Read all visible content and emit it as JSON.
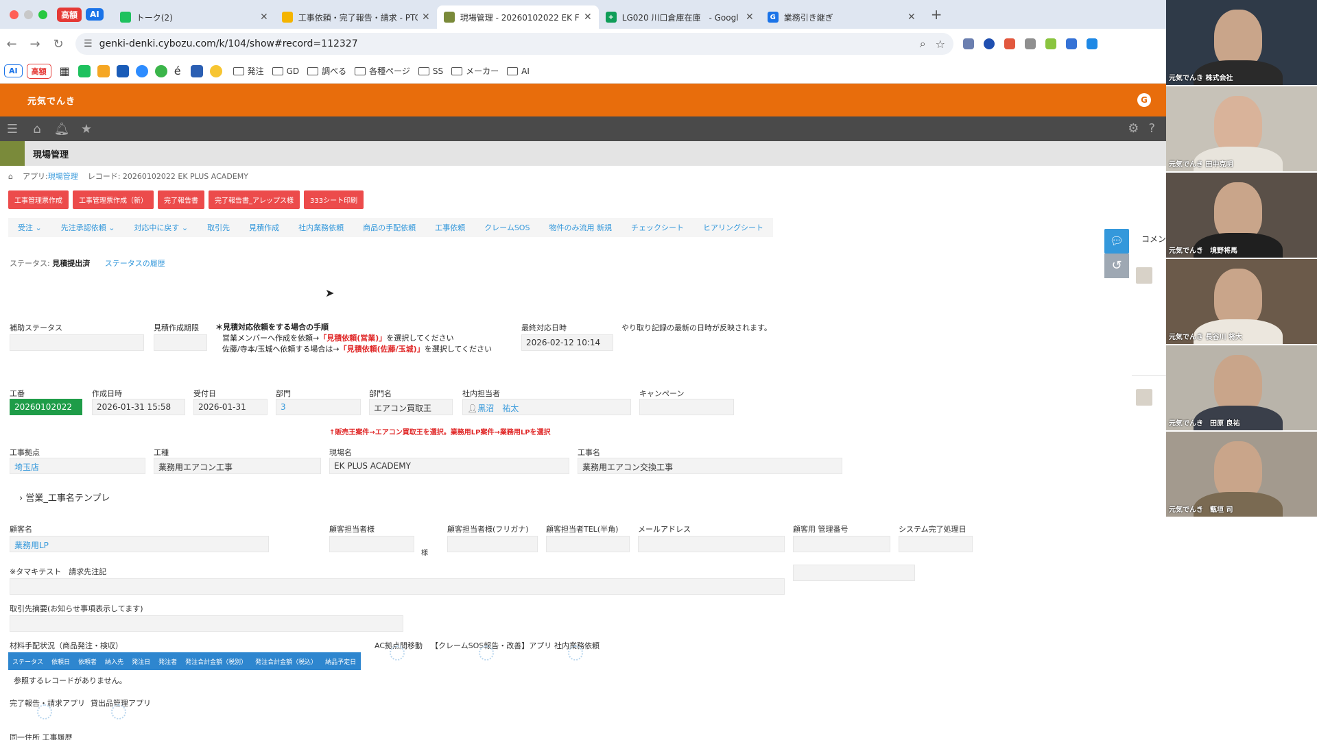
{
  "browser": {
    "pills": [
      "高額",
      "AI"
    ],
    "tabs": [
      {
        "title": "トーク(2)",
        "color": "#1ec15e"
      },
      {
        "title": "工事依頼・完了報告・請求 - PTC",
        "color": "#f4b400"
      },
      {
        "title": "現場管理 - 20260102022 EK F",
        "color": "#7a8a3a"
      },
      {
        "title": "LG020 川口倉庫在庫　- Googl",
        "color": "#0f9d58"
      },
      {
        "title": "業務引き継ぎ",
        "color": "#1a73e8"
      }
    ],
    "url": "genki-denki.cybozu.com/k/104/show#record=112327",
    "bookmarks": {
      "ai": "AI",
      "expensive": "高額",
      "folders": [
        "発注",
        "GD",
        "調べる",
        "各種ページ",
        "SS",
        "メーカー",
        "AI"
      ]
    }
  },
  "app": {
    "logo": "元気でんき",
    "user_initial": "G",
    "title": "現場管理",
    "breadcrumb_app_prefix": "アプリ:",
    "breadcrumb_app": "現場管理",
    "breadcrumb_record": "レコード: 20260102022 EK PLUS ACADEMY"
  },
  "red_buttons": [
    "工事管理票作成",
    "工事管理票作成（新）",
    "完了報告書",
    "完了報告書_アレップス様",
    "333シート印刷"
  ],
  "actions": [
    "受注",
    "先注承認依頼",
    "対応中に戻す",
    "取引先",
    "見積作成",
    "社内業務依頼",
    "商品の手配依頼",
    "工事依頼",
    "クレームSOS",
    "物件のみ流用 新規",
    "チェックシート",
    "ヒアリングシート"
  ],
  "status": {
    "label": "ステータス:",
    "value": "見積提出済",
    "history": "ステータスの履歴"
  },
  "fields": {
    "hojo_status": {
      "label": "補助ステータス",
      "value": ""
    },
    "mitsumori_kigen": {
      "label": "見積作成期限",
      "value": ""
    },
    "procedure": {
      "title": "＊見積対応依頼をする場合の手順",
      "line1_pre": "営業メンバーへ作成を依頼→",
      "line1_red": "「見積依頼(営業)」",
      "line1_post": "を選択してください",
      "line2_pre": "佐藤/寺本/玉城へ依頼する場合は→",
      "line2_red": "「見積依頼(佐藤/玉城)」",
      "line2_post": "を選択してください"
    },
    "last_response": {
      "label": "最終対応日時",
      "value": "2026-02-12 10:14"
    },
    "last_response_note": "やり取り記録の最新の日時が反映されます。",
    "koban": {
      "label": "工番",
      "value": "20260102022"
    },
    "created": {
      "label": "作成日時",
      "value": "2026-01-31 15:58"
    },
    "received": {
      "label": "受付日",
      "value": "2026-01-31"
    },
    "dept": {
      "label": "部門",
      "value": "3"
    },
    "dept_name": {
      "label": "部門名",
      "value": "エアコン買取王"
    },
    "staff": {
      "label": "社内担当者",
      "value": "黒沼　祐太"
    },
    "campaign": {
      "label": "キャンペーン",
      "value": ""
    },
    "red_note": "↑販売王案件→エアコン買取王を選択。業務用LP案件→業務用LPを選択",
    "base": {
      "label": "工事拠点",
      "value": "埼玉店"
    },
    "kind": {
      "label": "工種",
      "value": "業務用エアコン工事"
    },
    "site": {
      "label": "現場名",
      "value": "EK PLUS ACADEMY"
    },
    "work_name": {
      "label": "工事名",
      "value": "業務用エアコン交換工事"
    },
    "template_section": "営業_工事名テンプレ",
    "customer": {
      "label": "顧客名",
      "value": "業務用LP"
    },
    "cust_staff": {
      "label": "顧客担当者様",
      "value": "",
      "suffix": "様"
    },
    "cust_staff_kana": {
      "label": "顧客担当者様(フリガナ)",
      "value": ""
    },
    "cust_tel": {
      "label": "顧客担当者TEL(半角)",
      "value": ""
    },
    "email": {
      "label": "メールアドレス",
      "value": ""
    },
    "cust_mgmt": {
      "label": "顧客用 管理番号",
      "value": ""
    },
    "sys_done": {
      "label": "システム完了処理日",
      "value": ""
    },
    "tamaki_test": {
      "label": "※タマキテスト　請求先注記",
      "value": ""
    },
    "client_summary": {
      "label": "取引先摘要(お知らせ事項表示してます)",
      "value": ""
    }
  },
  "materials": {
    "label": "材料手配状況（商品発注・検収）",
    "columns": [
      "ステータス",
      "依頼日",
      "依頼者",
      "納入先",
      "発注日",
      "発注者",
      "発注合計金額（税別）",
      "発注合計金額（税込）",
      "納品予定日"
    ],
    "empty": "参照するレコードがありません。"
  },
  "related": {
    "ac_move": "AC拠点間移動",
    "claim": "【クレームSOS報告・改善】アプリ",
    "internal": "社内業務依頼",
    "complete": "完了報告・請求アプリ",
    "rental": "貸出品管理アプリ",
    "same_address": "同一住所 工事履歴"
  },
  "sidebar": {
    "comment": "コメン"
  },
  "participants": [
    "元気でんき 株式会社",
    "元気でんき 田中克明",
    "元気でんき　境野将馬",
    "元気でんき 長谷川 将大",
    "元気でんき　田原 良祐",
    "元気でんき　甑垣 司"
  ]
}
